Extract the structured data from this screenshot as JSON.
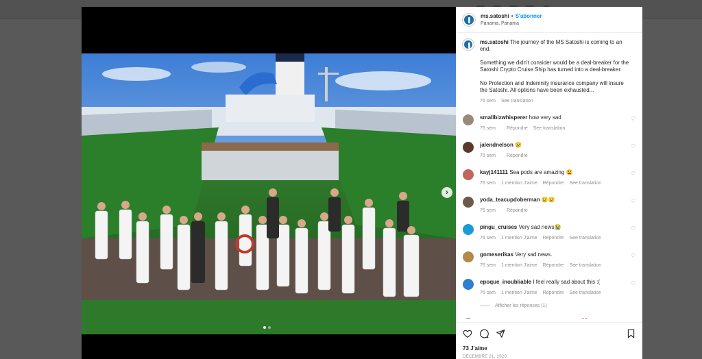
{
  "post": {
    "username": "ms.satoshi",
    "separator": "•",
    "follow_label": "S'abonner",
    "location": "Panama, Panama",
    "caption_lines": [
      "The journey of the MS Satoshi is coming to an end.",
      "Something we didn't consider would be a deal-breaker for the Satoshi Crypto Cruise Ship has turned into a deal-breaker.",
      "No Protection and Indemnity insurance company will insure the Satoshi. All options have been exhausted..."
    ],
    "caption_time": "76 sem",
    "see_translation": "See translation",
    "likes": "73 J'aime",
    "date": "DÉCEMBRE 21, 2020"
  },
  "comments": [
    {
      "user": "smallbizwhisperer",
      "text": "how very sad",
      "time": "75 sem",
      "likes": "",
      "reply": "Répondre",
      "translate": "See translation",
      "avatar_color": "#9a8a7a"
    },
    {
      "user": "jalendnelson",
      "text": "😢",
      "time": "76 sem",
      "likes": "",
      "reply": "Répondre",
      "translate": "",
      "avatar_color": "#5a3a2a"
    },
    {
      "user": "kayj141111",
      "text": "Sea pods are amazing 😩",
      "time": "76 sem",
      "likes": "1 mention J'aime",
      "reply": "Répondre",
      "translate": "See translation",
      "avatar_color": "#c0665a"
    },
    {
      "user": "yoda_teacupdoberman",
      "text": "😢😢",
      "time": "76 sem",
      "likes": "",
      "reply": "Répondre",
      "translate": "",
      "avatar_color": "#6b5a4a"
    },
    {
      "user": "pingu_cruises",
      "text": "Very sad news😭",
      "time": "76 sem",
      "likes": "1 mention J'aime",
      "reply": "Répondre",
      "translate": "See translation",
      "avatar_color": "#1a9bd7"
    },
    {
      "user": "gomeserikas",
      "text": "Very sad news.",
      "time": "76 sem",
      "likes": "1 mention J'aime",
      "reply": "Répondre",
      "translate": "See translation",
      "avatar_color": "#b5894a"
    },
    {
      "user": "epoque_inoubliable",
      "text": "I feel really sad about this :(",
      "time": "76 sem",
      "likes": "1 mention J'aime",
      "reply": "Répondre",
      "translate": "See translation",
      "avatar_color": "#2f7fd0"
    },
    {
      "user": "rigra.de.alvear",
      "text": "This are very sad news... ❤️",
      "time": "",
      "likes": "",
      "reply": "",
      "translate": "",
      "avatar_color": "#6a7a5a"
    }
  ],
  "replies_label": "Afficher les réponses (1)",
  "icons": [
    "heart-icon",
    "comment-icon",
    "share-icon",
    "bookmark-icon",
    "chevron-right-icon"
  ],
  "colors": {
    "link": "#0095f6",
    "muted": "#8e8e8e",
    "text": "#262626"
  }
}
